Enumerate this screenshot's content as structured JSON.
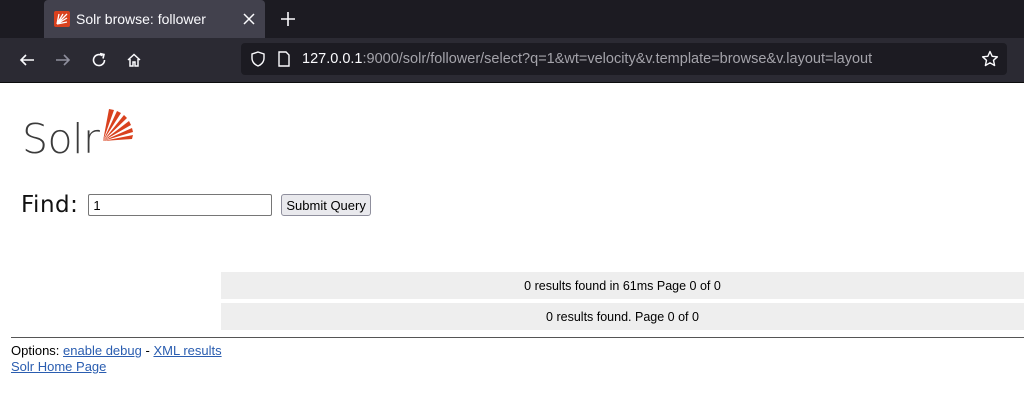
{
  "browser": {
    "tab_title": "Solr browse: follower",
    "url_host": "127.0.0.1",
    "url_rest": ":9000/solr/follower/select?q=1&wt=velocity&v.template=browse&v.layout=layout"
  },
  "logo": {
    "text": "Solr",
    "color": "#d9411e"
  },
  "search": {
    "label": "Find:",
    "value": "1",
    "submit_label": "Submit Query"
  },
  "results": {
    "top_text": "0 results found in 61ms Page 0 of 0",
    "bottom_text": "0 results found. Page 0 of 0"
  },
  "footer": {
    "options_label": "Options:",
    "enable_debug": "enable debug",
    "separator": "-",
    "xml_results": "XML results",
    "home_page": "Solr Home Page"
  }
}
